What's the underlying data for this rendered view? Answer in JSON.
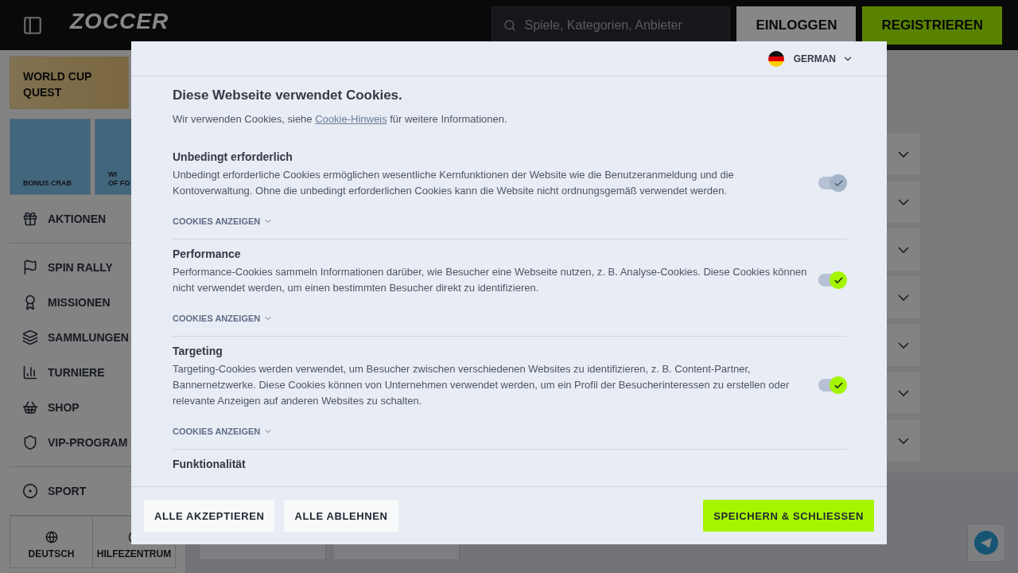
{
  "header": {
    "logo": "ZOCCER",
    "search": {
      "placeholder": "Spiele, Kategorien, Anbieter"
    },
    "buttons": [
      {
        "label": "EINLOGGEN",
        "kind": "secondary"
      },
      {
        "label": "REGISTRIEREN",
        "kind": "primary"
      }
    ]
  },
  "sidebar": {
    "promo": "WORLD CUP QUEST",
    "tiles": [
      {
        "lines": [
          "BONUS CRAB"
        ]
      },
      {
        "lines": [
          "WI",
          "OF FO"
        ]
      }
    ],
    "nav_groups": [
      [
        "AKTIONEN"
      ],
      [
        "SPIN RALLY",
        "MISSIONEN",
        "SAMMLUNGEN",
        "TURNIERE",
        "SHOP",
        "VIP-PROGRAM"
      ],
      [
        "SPORT"
      ]
    ],
    "footer_links": [
      "DEUTSCH",
      "HILFEZENTRUM"
    ]
  },
  "main": {
    "accordion": [
      {
        "expanded": false
      },
      {
        "expanded": false
      },
      {
        "expanded": false
      },
      {
        "expanded": false
      },
      {
        "expanded": false
      },
      {
        "expanded": false
      },
      {
        "expanded": false
      }
    ]
  },
  "cookie_dialog": {
    "language": "GERMAN",
    "title": "Diese Webseite verwendet Cookies.",
    "intro": {
      "before": "Wir verwenden Cookies, siehe",
      "link": "Cookie-Hinweis",
      "after": "für weitere Informationen."
    },
    "categories": [
      {
        "title": "Unbedingt erforderlich",
        "description": "Unbedingt erforderliche Cookies ermöglichen wesentliche Kernfunktionen der Website wie die Benutzeranmeldung und die Kontoverwaltung. Ohne die unbedingt erforderlichen Cookies kann die Website nicht ordnungsgemäß verwendet werden.",
        "on": true,
        "disabled": true,
        "details_label": "COOKIES ANZEIGEN",
        "expanded": false
      },
      {
        "title": "Performance",
        "description": "Performance-Cookies sammeln Informationen darüber, wie Besucher eine Webseite nutzen, z. B. Analyse-Cookies. Diese Cookies können nicht verwendet werden, um einen bestimmten Besucher direkt zu identifizieren.",
        "on": true,
        "disabled": false,
        "details_label": "COOKIES ANZEIGEN",
        "expanded": false
      },
      {
        "title": "Targeting",
        "description": "Targeting-Cookies werden verwendet, um Besucher zwischen verschiedenen Websites zu identifizieren, z. B. Content-Partner, Bannernetzwerke. Diese Cookies können von Unternehmen verwendet werden, um ein Profil der Besucherinteressen zu erstellen oder relevante Anzeigen auf anderen Websites zu schalten.",
        "on": true,
        "disabled": false,
        "details_label": "COOKIES ANZEIGEN",
        "expanded": false
      },
      {
        "title": "Funktionalität"
      }
    ],
    "buttons": [
      {
        "label": "ALLE AKZEPTIEREN",
        "kind": "secondary"
      },
      {
        "label": "ALLE ABLEHNEN",
        "kind": "secondary"
      },
      {
        "label": "SPEICHERN & SCHLIESSEN",
        "kind": "primary"
      }
    ]
  }
}
